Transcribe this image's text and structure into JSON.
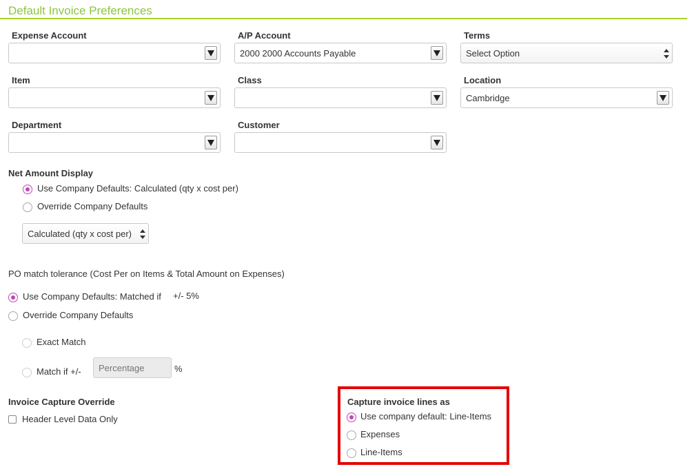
{
  "section": {
    "title": "Default Invoice Preferences"
  },
  "fields": {
    "expense_account": {
      "label": "Expense Account",
      "value": ""
    },
    "ap_account": {
      "label": "A/P Account",
      "value": "2000 2000 Accounts Payable"
    },
    "terms": {
      "label": "Terms",
      "value": "Select Option"
    },
    "item": {
      "label": "Item",
      "value": ""
    },
    "class": {
      "label": "Class",
      "value": ""
    },
    "location": {
      "label": "Location",
      "value": "Cambridge"
    },
    "department": {
      "label": "Department",
      "value": ""
    },
    "customer": {
      "label": "Customer",
      "value": ""
    }
  },
  "net_amount": {
    "title": "Net Amount Display",
    "option_default": "Use Company Defaults: Calculated (qty x cost per)",
    "option_override": "Override Company Defaults",
    "select_value": "Calculated (qty x cost per)",
    "selected": "default"
  },
  "po_match": {
    "title": "PO match tolerance (Cost Per on Items & Total Amount on Expenses)",
    "option_default": "Use Company Defaults: Matched if",
    "default_tolerance": "+/- 5%",
    "option_override": "Override Company Defaults",
    "exact_match": "Exact Match",
    "match_if": "Match if +/-",
    "percentage_placeholder": "Percentage",
    "percent_sign": "%",
    "selected": "default"
  },
  "capture_override": {
    "title": "Invoice Capture Override",
    "header_level_only": "Header Level Data Only",
    "checked": false
  },
  "capture_lines": {
    "title": "Capture invoice lines as",
    "option_default": "Use company default: Line-Items",
    "option_expenses": "Expenses",
    "option_line_items": "Line-Items",
    "selected": "default"
  },
  "colors": {
    "accent_green": "#8cc63f",
    "radio_selected": "#c145b6",
    "highlight_red": "#e40000"
  }
}
